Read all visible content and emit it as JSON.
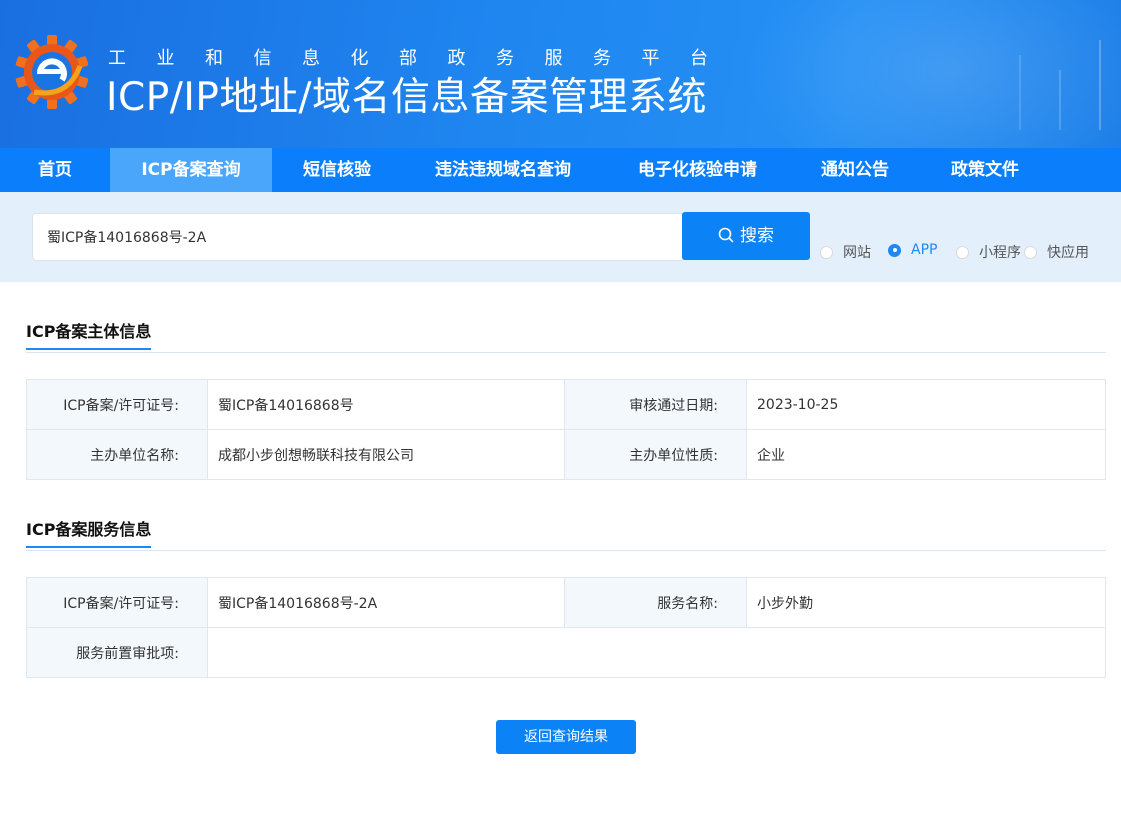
{
  "header": {
    "subtitle": "工业和信息化部政务服务平台",
    "title": "ICP/IP地址/域名信息备案管理系统"
  },
  "nav": {
    "items": [
      {
        "label": "首页",
        "active": false
      },
      {
        "label": "ICP备案查询",
        "active": true
      },
      {
        "label": "短信核验",
        "active": false
      },
      {
        "label": "违法违规域名查询",
        "active": false
      },
      {
        "label": "电子化核验申请",
        "active": false
      },
      {
        "label": "通知公告",
        "active": false
      },
      {
        "label": "政策文件",
        "active": false
      }
    ]
  },
  "search": {
    "value": "蜀ICP备14016868号-2A",
    "button_label": "搜索",
    "button_icon": "search-icon",
    "types": [
      {
        "label": "网站",
        "checked": false
      },
      {
        "label": "APP",
        "checked": true
      },
      {
        "label": "小程序",
        "checked": false
      },
      {
        "label": "快应用",
        "checked": false
      }
    ]
  },
  "subject": {
    "title": "ICP备案主体信息",
    "rows": [
      {
        "k1": "ICP备案/许可证号:",
        "v1": "蜀ICP备14016868号",
        "k2": "审核通过日期:",
        "v2": "2023-10-25"
      },
      {
        "k1": "主办单位名称:",
        "v1": "成都小步创想畅联科技有限公司",
        "k2": "主办单位性质:",
        "v2": "企业"
      }
    ]
  },
  "service": {
    "title": "ICP备案服务信息",
    "rows": [
      {
        "k1": "ICP备案/许可证号:",
        "v1": "蜀ICP备14016868号-2A",
        "k2": "服务名称:",
        "v2": "小步外勤"
      }
    ],
    "approval_label": "服务前置审批项:",
    "approval_value": ""
  },
  "back_button": "返回查询结果",
  "colors": {
    "primary": "#0b82f6",
    "nav_bg": "#0b7ffb",
    "nav_active": "#4aa6fb",
    "search_band": "#e3f0fc"
  }
}
